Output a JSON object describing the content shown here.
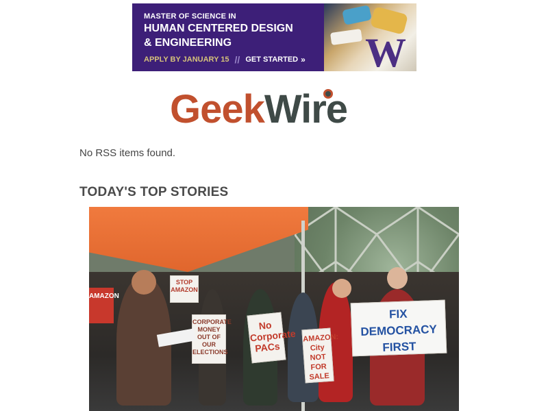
{
  "ad": {
    "kicker": "MASTER OF SCIENCE IN",
    "title_line1": "HUMAN CENTERED DESIGN",
    "title_line2": "& ENGINEERING",
    "apply": "APPLY BY JANUARY 15",
    "divider": "//",
    "cta": "GET STARTED",
    "cta_chevron": "»",
    "logo_letter": "W",
    "colors": {
      "background": "#3d1f78",
      "apply": "#d6c27a",
      "logo": "#4b2e83"
    }
  },
  "site": {
    "logo_part1": "Geek",
    "logo_part2": "Wire",
    "colors": {
      "geek": "#c1502e",
      "wire": "#3f4a47"
    }
  },
  "rss_message": "No RSS items found.",
  "section_heading": "TODAY'S TOP STORIES",
  "story": {
    "signs": {
      "fix": [
        "FIX",
        "DEMOCRACY",
        "FIRST"
      ],
      "no_corp": [
        "No",
        "Corporate",
        "PACs"
      ],
      "corporate": [
        "CORPORATE",
        "MONEY",
        "OUT OF OUR",
        "ELECTIONS"
      ],
      "amazon": [
        "AMAZON:",
        "City",
        "NOT",
        "FOR SALE"
      ],
      "stop": [
        "STOP",
        "AMAZON"
      ],
      "left": [
        "AMAZON"
      ]
    }
  }
}
